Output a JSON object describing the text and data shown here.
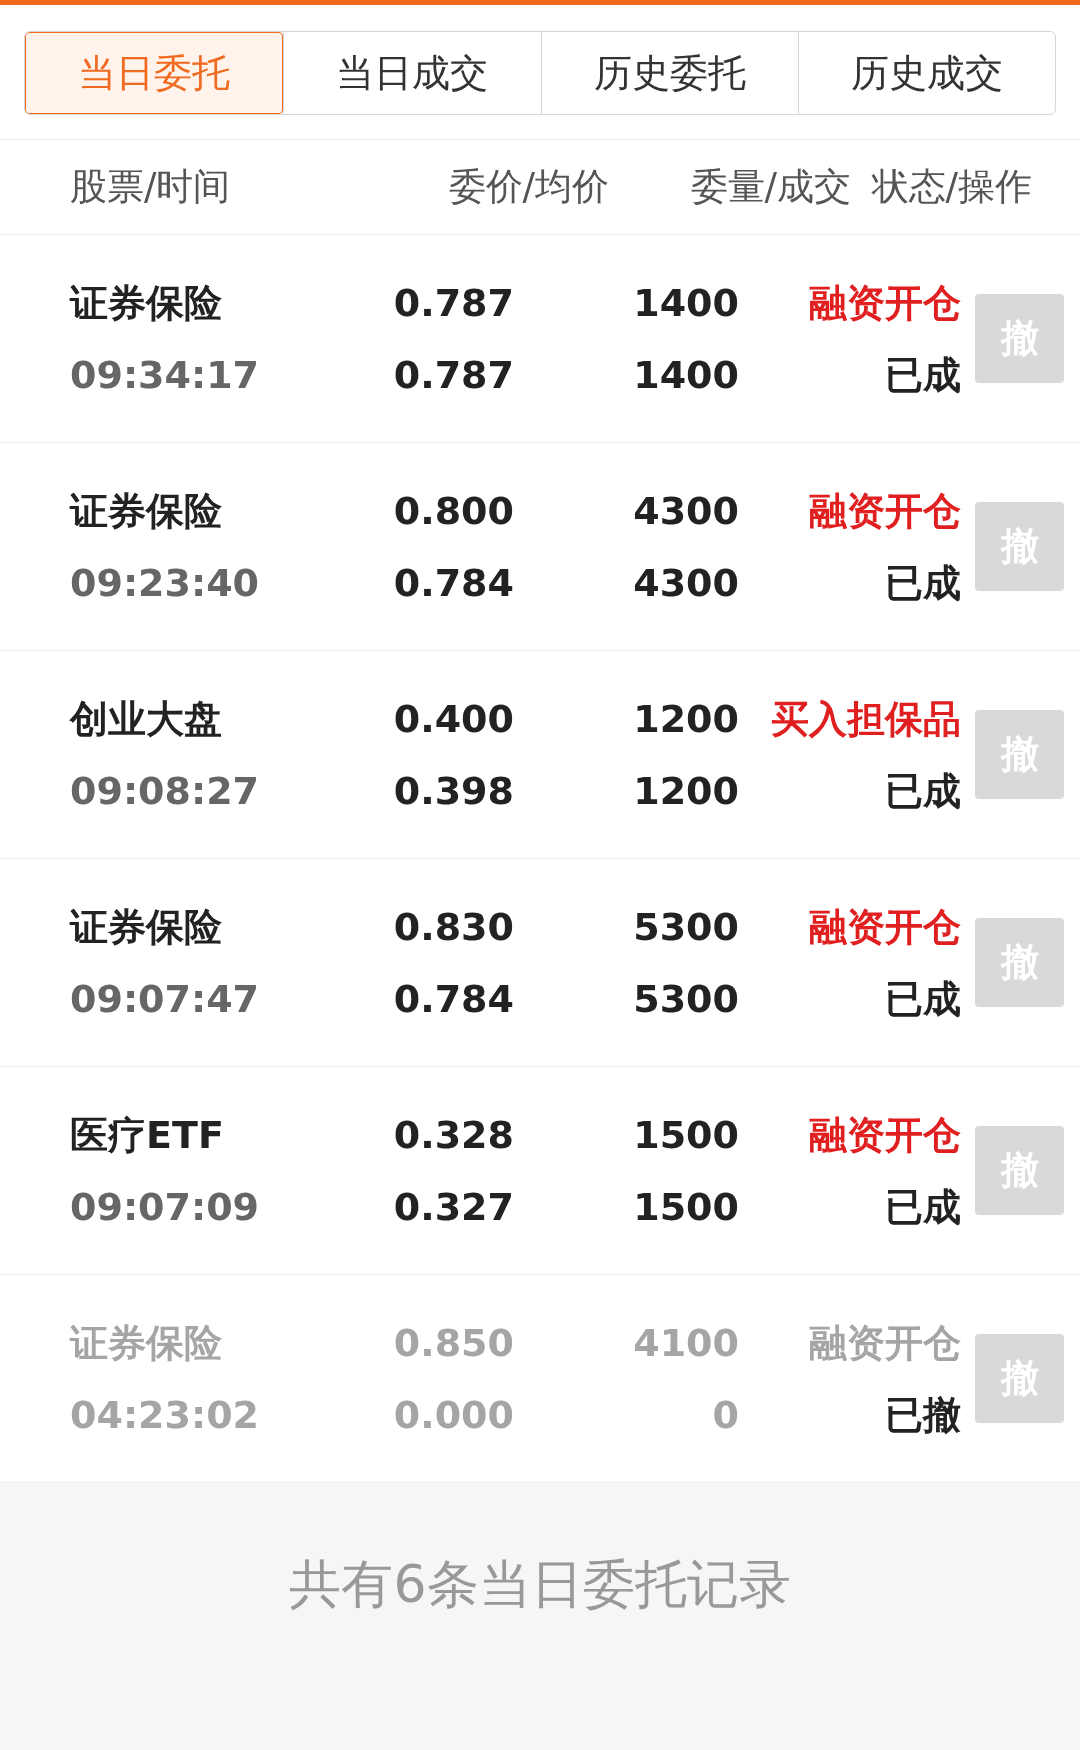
{
  "tabs": [
    {
      "label": "当日委托",
      "selected": true
    },
    {
      "label": "当日成交",
      "selected": false
    },
    {
      "label": "历史委托",
      "selected": false
    },
    {
      "label": "历史成交",
      "selected": false
    }
  ],
  "columns": [
    "股票/时间",
    "委价/均价",
    "委量/成交",
    "状态/操作"
  ],
  "orders": [
    {
      "name": "证券保险",
      "time": "09:34:17",
      "price": "0.787",
      "avg_price": "0.787",
      "quantity": "1400",
      "filled": "1400",
      "type": "融资开仓",
      "status": "已成",
      "active": true,
      "cancel": "撤"
    },
    {
      "name": "证券保险",
      "time": "09:23:40",
      "price": "0.800",
      "avg_price": "0.784",
      "quantity": "4300",
      "filled": "4300",
      "type": "融资开仓",
      "status": "已成",
      "active": true,
      "cancel": "撤"
    },
    {
      "name": "创业大盘",
      "time": "09:08:27",
      "price": "0.400",
      "avg_price": "0.398",
      "quantity": "1200",
      "filled": "1200",
      "type": "买入担保品",
      "status": "已成",
      "active": true,
      "cancel": "撤"
    },
    {
      "name": "证券保险",
      "time": "09:07:47",
      "price": "0.830",
      "avg_price": "0.784",
      "quantity": "5300",
      "filled": "5300",
      "type": "融资开仓",
      "status": "已成",
      "active": true,
      "cancel": "撤"
    },
    {
      "name": "医疗ETF",
      "time": "09:07:09",
      "price": "0.328",
      "avg_price": "0.327",
      "quantity": "1500",
      "filled": "1500",
      "type": "融资开仓",
      "status": "已成",
      "active": true,
      "cancel": "撤"
    },
    {
      "name": "证券保险",
      "time": "04:23:02",
      "price": "0.850",
      "avg_price": "0.000",
      "quantity": "4100",
      "filled": "0",
      "type": "融资开仓",
      "status": "已撤",
      "active": false,
      "cancel": "撤"
    }
  ],
  "footer": "共有6条当日委托记录"
}
